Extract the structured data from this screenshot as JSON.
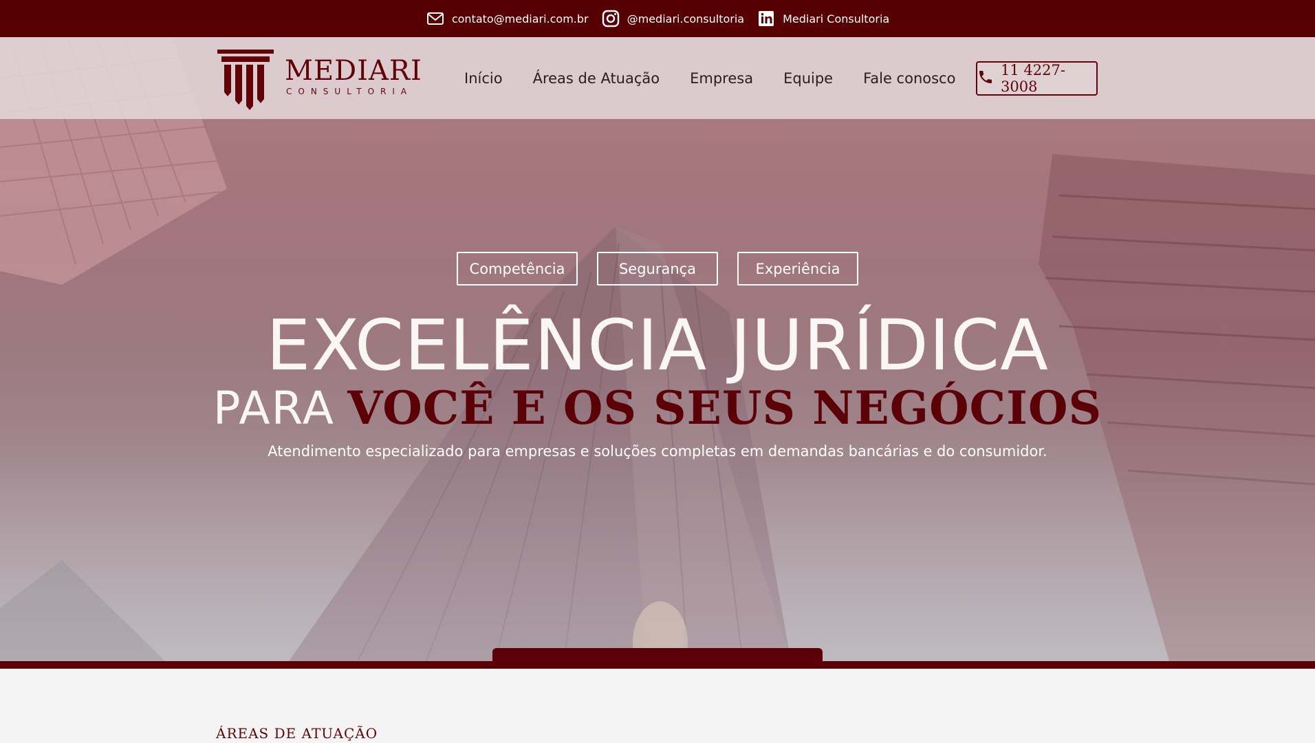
{
  "topbar": {
    "email": "contato@mediari.com.br",
    "instagram": "@mediari.consultoria",
    "linkedin": "Mediari Consultoria",
    "icons": [
      "mail-icon",
      "instagram-icon",
      "linkedin-icon"
    ]
  },
  "brand": {
    "name": "MEDIARI",
    "subtitle": "CONSULTORIA"
  },
  "nav": {
    "items": [
      {
        "label": "Início"
      },
      {
        "label": "Áreas de Atuação"
      },
      {
        "label": "Empresa"
      },
      {
        "label": "Equipe"
      },
      {
        "label": "Fale conosco"
      }
    ],
    "phone": "11 4227-3008"
  },
  "hero": {
    "pills": [
      {
        "label": "Competência"
      },
      {
        "label": "Segurança"
      },
      {
        "label": "Experiência"
      }
    ],
    "headline": "EXCELÊNCIA JURÍDICA",
    "subhead_plain": "PARA",
    "subhead_accent": "VOCÊ E OS SEUS NEGÓCIOS",
    "tagline": "Atendimento especializado para empresas e soluções completas em demandas bancárias e do consumidor."
  },
  "sections": {
    "areas_title": "ÁREAS DE ATUAÇÃO"
  },
  "colors": {
    "brand": "#560003",
    "accent": "#5a0006",
    "text_light": "#ffffff"
  }
}
